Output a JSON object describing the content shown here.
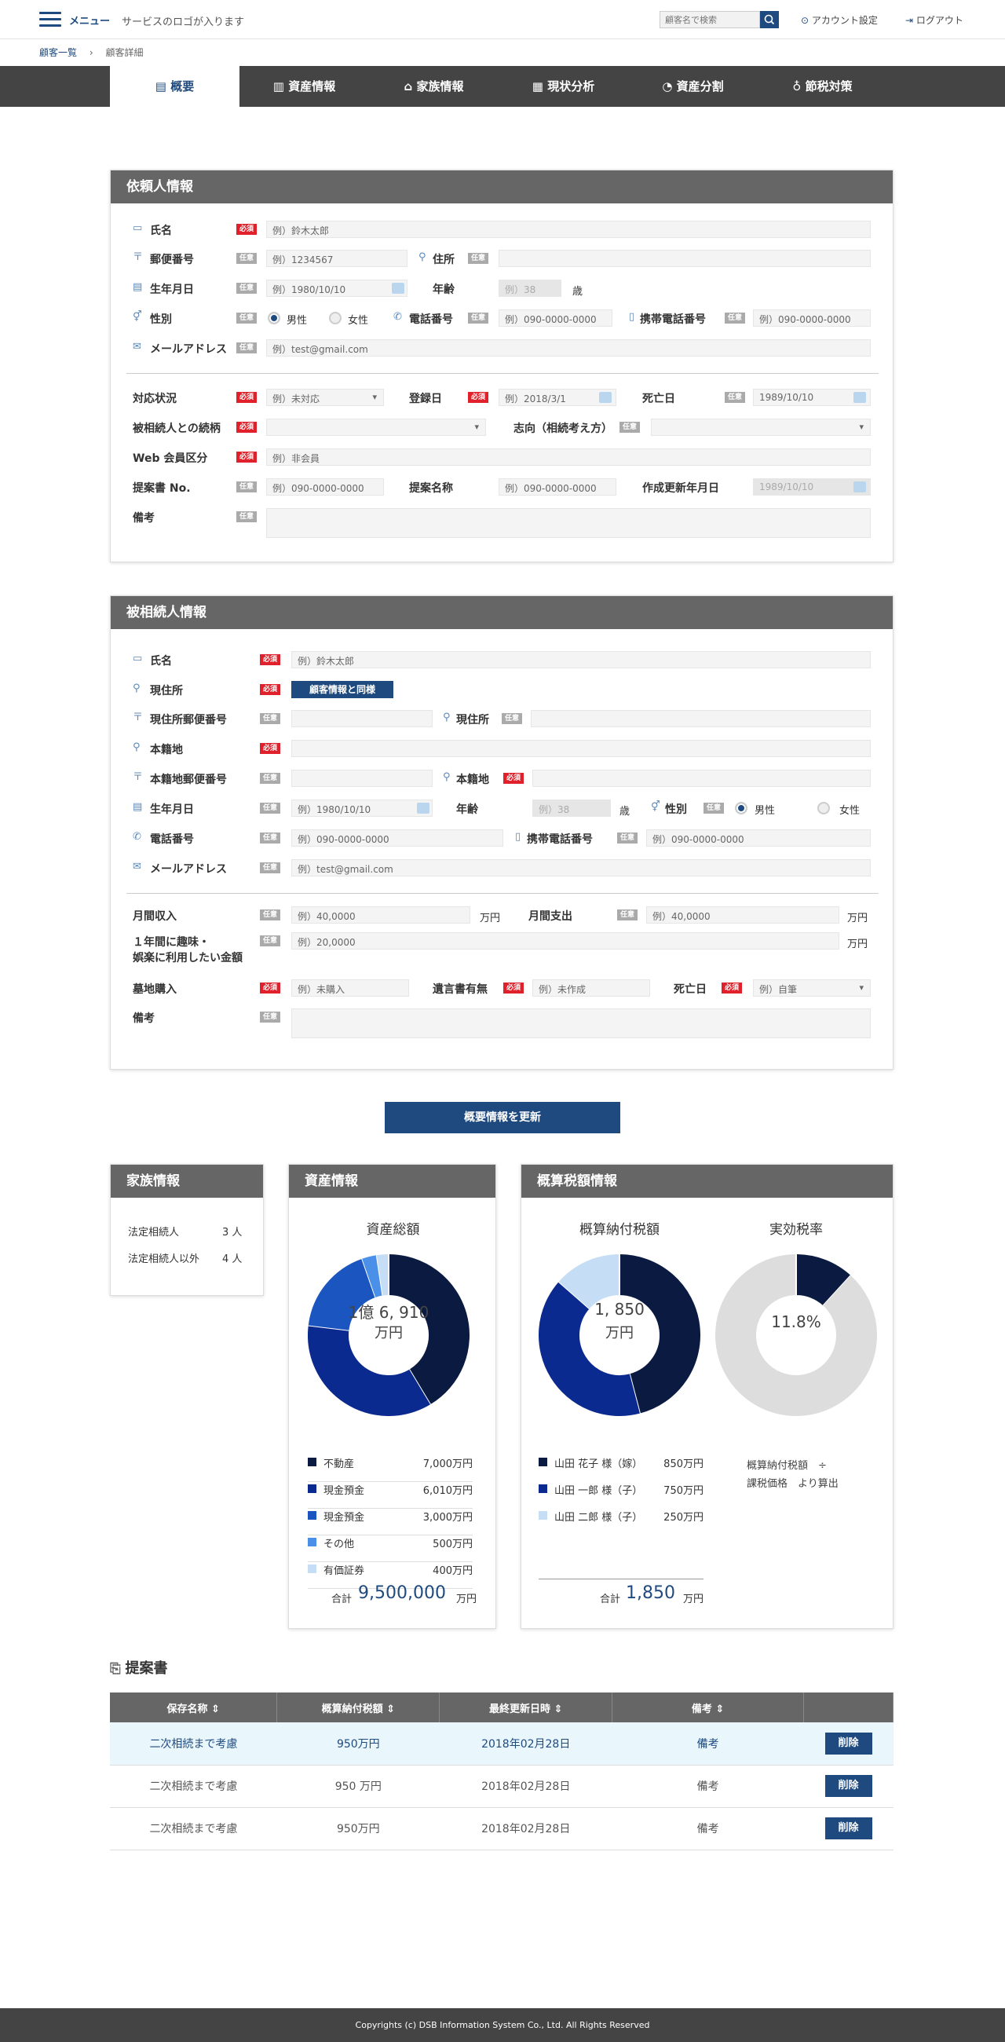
{
  "header": {
    "menu": "メニュー",
    "logo": "サービスのロゴが入ります",
    "search_placeholder": "顧客名で検索",
    "account": "アカウント設定",
    "logout": "ログアウト"
  },
  "breadcrumb": {
    "list": "顧客一覧",
    "current": "顧客詳細"
  },
  "tabs": [
    "概要",
    "資産情報",
    "家族情報",
    "現状分析",
    "資産分割",
    "節税対策"
  ],
  "badges": {
    "req": "必須",
    "opt": "任意"
  },
  "client": {
    "title": "依頼人情報",
    "name_label": "氏名",
    "name_ph": "例）鈴木太郎",
    "zip_label": "郵便番号",
    "zip_ph": "例）1234567",
    "addr_label": "住所",
    "birth_label": "生年月日",
    "birth_ph": "例）1980/10/10",
    "age_label": "年齢",
    "age_ph": "例）38",
    "age_unit": "歳",
    "gender_label": "性別",
    "male": "男性",
    "female": "女性",
    "tel_label": "電話番号",
    "tel_ph": "例）090-0000-0000",
    "mobile_label": "携帯電話番号",
    "mobile_ph": "例）090-0000-0000",
    "mail_label": "メールアドレス",
    "mail_ph": "例）test@gmail.com",
    "status_label": "対応状況",
    "status_ph": "例）未対応",
    "reg_label": "登録日",
    "reg_ph": "例）2018/3/1",
    "death_label": "死亡日",
    "death_ph": "1989/10/10",
    "rel_label": "被相続人との続柄",
    "intent_label": "志向（相続考え方）",
    "web_label": "Web 会員区分",
    "web_ph": "例）非会員",
    "prop_label": "提案書 No.",
    "prop_ph": "例）090-0000-0000",
    "propname_label": "提案名称",
    "propname_ph": "例）090-0000-0000",
    "upd_label": "作成更新年月日",
    "upd_ph": "1989/10/10",
    "memo_label": "備考"
  },
  "decedent": {
    "title": "被相続人情報",
    "name_label": "氏名",
    "name_ph": "例）鈴木太郎",
    "cur_label": "現住所",
    "same_btn": "顧客情報と同様",
    "curzip_label": "現住所郵便番号",
    "curaddr_label": "現住所",
    "domicile_label": "本籍地",
    "domzip_label": "本籍地郵便番号",
    "domaddr_label": "本籍地",
    "birth_label": "生年月日",
    "birth_ph": "例）1980/10/10",
    "age_label": "年齢",
    "age_ph": "例）38",
    "age_unit": "歳",
    "gender_label": "性別",
    "male": "男性",
    "female": "女性",
    "tel_label": "電話番号",
    "tel_ph": "例）090-0000-0000",
    "mobile_label": "携帯電話番号",
    "mobile_ph": "例）090-0000-0000",
    "mail_label": "メールアドレス",
    "mail_ph": "例）test@gmail.com",
    "income_label": "月間収入",
    "income_ph": "例）40,0000",
    "yen": "万円",
    "expense_label": "月間支出",
    "expense_ph": "例）40,0000",
    "hobby_label1": "１年間に趣味・",
    "hobby_label2": "娯楽に利用したい金額",
    "hobby_ph": "例）20,0000",
    "grave_label": "墓地購入",
    "grave_ph": "例）未購入",
    "will_label": "遺言書有無",
    "will_ph": "例）未作成",
    "death_label": "死亡日",
    "death_ph": "例）自筆",
    "memo_label": "備考"
  },
  "update_btn": "概要情報を更新",
  "family": {
    "title": "家族情報",
    "legal": "法定相続人",
    "legal_n": "3 人",
    "other": "法定相続人以外",
    "other_n": "4 人"
  },
  "assets": {
    "title": "資産情報",
    "total_title": "資産総額",
    "center1": "1億 6, 910",
    "center2": "万円",
    "items": [
      {
        "name": "不動産",
        "value": "7,000万円",
        "color": "#0a1a40"
      },
      {
        "name": "現金預金",
        "value": "6,010万円",
        "color": "#0a2a8f"
      },
      {
        "name": "現金預金",
        "value": "3,000万円",
        "color": "#1a55c0"
      },
      {
        "name": "その他",
        "value": "500万円",
        "color": "#4a90e8"
      },
      {
        "name": "有価証券",
        "value": "400万円",
        "color": "#c6def5"
      }
    ],
    "sum_label": "合計",
    "sum": "9,500,000",
    "sum_unit": "万円"
  },
  "tax": {
    "title": "概算税額情報",
    "pay_title": "概算納付税額",
    "rate_title": "実効税率",
    "center1": "1, 850",
    "center2": "万円",
    "rate": "11.8%",
    "items": [
      {
        "name": "山田 花子 様（嫁）",
        "value": "850万円",
        "color": "#0a1a40"
      },
      {
        "name": "山田 一郎 様（子）",
        "value": "750万円",
        "color": "#0a2a8f"
      },
      {
        "name": "山田 二郎 様（子）",
        "value": "250万円",
        "color": "#c6def5"
      }
    ],
    "note1": "概算納付税額　÷",
    "note2": "課税価格　より算出",
    "sum_label": "合計",
    "sum": "1,850",
    "sum_unit": "万円"
  },
  "chart_data": [
    {
      "type": "pie",
      "title": "資産総額",
      "categories": [
        "不動産",
        "現金預金",
        "現金預金",
        "その他",
        "有価証券"
      ],
      "values": [
        7000,
        6010,
        3000,
        500,
        400
      ]
    },
    {
      "type": "pie",
      "title": "概算納付税額",
      "categories": [
        "山田 花子 様（嫁）",
        "山田 一郎 様（子）",
        "山田 二郎 様（子）"
      ],
      "values": [
        850,
        750,
        250
      ]
    },
    {
      "type": "pie",
      "title": "実効税率",
      "categories": [
        "実効税率",
        ""
      ],
      "values": [
        11.8,
        88.2
      ]
    }
  ],
  "proposals": {
    "title": "提案書",
    "headers": [
      "保存名称 ⇕",
      "概算納付税額 ⇕",
      "最終更新日時 ⇕",
      "備考 ⇕",
      ""
    ],
    "rows": [
      [
        "二次相続まで考慮",
        "950万円",
        "2018年02月28日",
        "備考",
        "削除"
      ],
      [
        "二次相続まで考慮",
        "950 万円",
        "2018年02月28日",
        "備考",
        "削除"
      ],
      [
        "二次相続まで考慮",
        "950万円",
        "2018年02月28日",
        "備考",
        "削除"
      ]
    ]
  },
  "footer": "Copyrights (c) DSB Information System Co., Ltd. All Rights Reserved"
}
